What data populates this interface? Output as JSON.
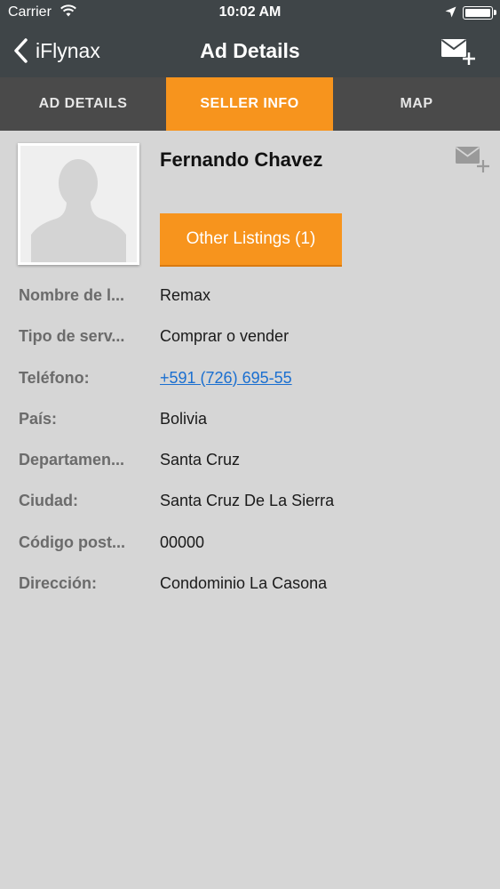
{
  "status_bar": {
    "carrier": "Carrier",
    "time": "10:02 AM"
  },
  "nav": {
    "back_label": "iFlynax",
    "title": "Ad Details"
  },
  "tabs": [
    {
      "label": "AD DETAILS",
      "active": false
    },
    {
      "label": "SELLER INFO",
      "active": true
    },
    {
      "label": "MAP",
      "active": false
    }
  ],
  "seller": {
    "name": "Fernando Chavez",
    "other_listings_label": "Other Listings (1)"
  },
  "details": [
    {
      "label": "Nombre de l...",
      "value": "Remax"
    },
    {
      "label": "Tipo de serv...",
      "value": "Comprar o vender"
    },
    {
      "label": "Teléfono:",
      "value": "+591 (726) 695-55"
    },
    {
      "label": "País:",
      "value": "Bolivia"
    },
    {
      "label": "Departamen...",
      "value": "Santa Cruz"
    },
    {
      "label": "Ciudad:",
      "value": "Santa Cruz De La Sierra"
    },
    {
      "label": "Código post...",
      "value": "00000"
    },
    {
      "label": "Dirección:",
      "value": "Condominio La Casona"
    }
  ],
  "colors": {
    "accent": "#f7941d",
    "header": "#3f4548",
    "tabbar": "#4a4a4a",
    "background": "#d6d6d6",
    "link": "#1a6fd0"
  },
  "icons": [
    "wifi-icon",
    "location-arrow-icon",
    "battery-icon",
    "chevron-left-icon",
    "mail-add-icon",
    "avatar-placeholder-icon",
    "contact-mail-icon"
  ]
}
